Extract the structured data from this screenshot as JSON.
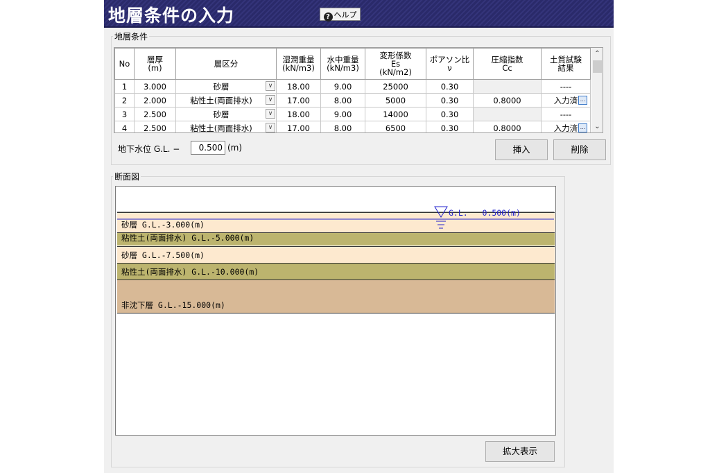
{
  "window": {
    "title": "地層条件の入力",
    "help_label": "ヘルプ",
    "help_icon": "question-icon"
  },
  "strata": {
    "group_label": "地層条件",
    "columns": [
      "No",
      "層厚\n(m)",
      "層区分",
      "湿潤重量\n(kN/m3)",
      "水中重量\n(kN/m3)",
      "変形係数\nEs\n(kN/m2)",
      "ポアソン比\nν",
      "圧縮指数\nCc",
      "土質試験\n結果"
    ],
    "rows": [
      {
        "no": "1",
        "thickness": "3.000",
        "type": "砂層",
        "wet": "18.00",
        "sub": "9.00",
        "es": "25000",
        "nu": "0.30",
        "cc": "",
        "result": "----"
      },
      {
        "no": "2",
        "thickness": "2.000",
        "type": "粘性土(両面排水)",
        "wet": "17.00",
        "sub": "8.00",
        "es": "5000",
        "nu": "0.30",
        "cc": "0.8000",
        "result": "入力済"
      },
      {
        "no": "3",
        "thickness": "2.500",
        "type": "砂層",
        "wet": "18.00",
        "sub": "9.00",
        "es": "14000",
        "nu": "0.30",
        "cc": "",
        "result": "----"
      },
      {
        "no": "4",
        "thickness": "2.500",
        "type": "粘性土(両面排水)",
        "wet": "17.00",
        "sub": "8.00",
        "es": "6500",
        "nu": "0.30",
        "cc": "0.8000",
        "result": "入力済"
      }
    ],
    "groundwater_label": "地下水位  G.L. −",
    "groundwater_value": "0.500",
    "groundwater_unit": "(m)",
    "insert_label": "挿入",
    "delete_label": "削除"
  },
  "section": {
    "group_label": "断面図",
    "gl_label": "G.L.",
    "water_label": "0.500(m)",
    "layers": [
      {
        "label": "砂層 G.L.-3.000(m)",
        "color": "#fde9cf"
      },
      {
        "label": "粘性土(両面排水) G.L.-5.000(m)",
        "color": "#bcb46e"
      },
      {
        "label": "砂層 G.L.-7.500(m)",
        "color": "#fde9cf"
      },
      {
        "label": "粘性土(両面排水) G.L.-10.000(m)",
        "color": "#bcb46e"
      },
      {
        "label": "非沈下層 G.L.-15.000(m)",
        "color": "#d8b996"
      }
    ],
    "water_color": "#2222cc",
    "zoom_label": "拡大表示"
  }
}
